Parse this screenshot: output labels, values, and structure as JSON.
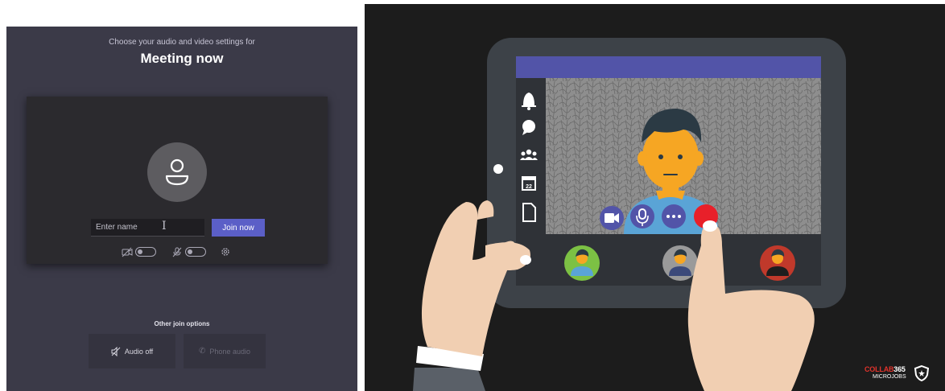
{
  "teams_join": {
    "subtitle": "Choose your audio and video settings for",
    "title": "Meeting now",
    "name_placeholder": "Enter name",
    "join_button": "Join now",
    "other_options_label": "Other join options",
    "audio_off_label": "Audio off",
    "phone_audio_label": "Phone audio"
  },
  "illustration": {
    "brand_line1_red": "COLLAB",
    "brand_line1_white": "365",
    "brand_line2": "MICROJOBS",
    "colors": {
      "tablet_frame": "#3d4248",
      "teams_purple": "#5254a8",
      "end_call_red": "#e8202a",
      "participant_green": "#7cc144",
      "participant_gray": "#9a9a9a",
      "participant_red": "#c0392b"
    },
    "icons": [
      "bell-icon",
      "chat-icon",
      "teams-icon",
      "calendar-icon",
      "file-icon",
      "video-icon",
      "microphone-icon",
      "more-icon",
      "end-call-icon"
    ]
  }
}
